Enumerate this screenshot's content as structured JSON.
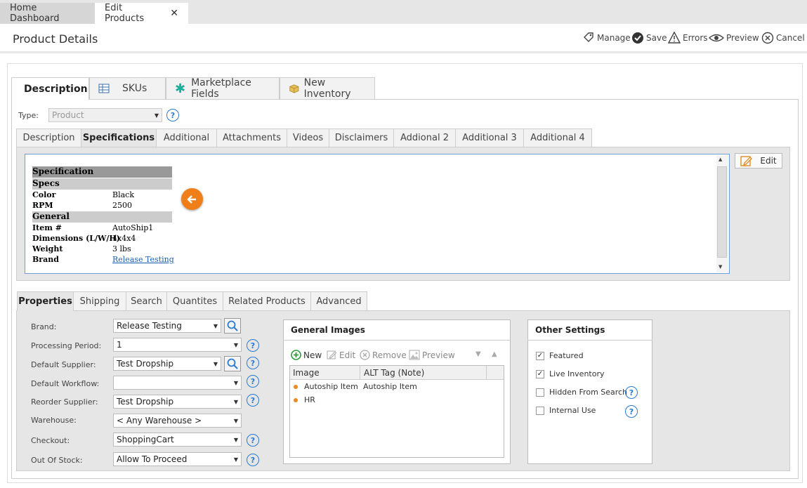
{
  "tabs": {
    "home": "Home Dashboard",
    "edit": "Edit Products"
  },
  "header": {
    "title": "Product Details",
    "manage": "Manage",
    "save": "Save",
    "errors": "Errors",
    "preview": "Preview",
    "cancel": "Cancel"
  },
  "main_tabs": [
    "Description",
    "SKUs",
    "Marketplace Fields",
    "New Inventory"
  ],
  "type": {
    "label": "Type:",
    "value": "Product"
  },
  "sub_tabs": [
    "Description",
    "Specifications",
    "Additional",
    "Attachments",
    "Videos",
    "Disclaimers",
    "Addional 2",
    "Additional 3",
    "Additional 4"
  ],
  "spec": {
    "heading": "Specification",
    "specs_title": "Specs",
    "specs": [
      {
        "k": "Color",
        "v": "Black"
      },
      {
        "k": "RPM",
        "v": "2500"
      }
    ],
    "general_title": "General",
    "general": [
      {
        "k": "Item #",
        "v": "AutoShip1"
      },
      {
        "k": "Dimensions (L/W/H)",
        "v": "4x4x4"
      },
      {
        "k": "Weight",
        "v": "3 lbs"
      }
    ],
    "brand_key": "Brand",
    "brand_link": "Release Testing"
  },
  "edit_label": "Edit",
  "prop_tabs": [
    "Properties",
    "Shipping",
    "Search",
    "Quantites",
    "Related Products",
    "Advanced"
  ],
  "form": {
    "brand": {
      "label": "Brand:",
      "value": "Release Testing"
    },
    "processing": {
      "label": "Processing Period:",
      "value": "1"
    },
    "supplier": {
      "label": "Default Supplier:",
      "value": "Test Dropship"
    },
    "workflow": {
      "label": "Default Workflow:",
      "value": ""
    },
    "reorder": {
      "label": "Reorder Supplier:",
      "value": "Test Dropship"
    },
    "warehouse": {
      "label": "Warehouse:",
      "value": "< Any Warehouse >"
    },
    "checkout": {
      "label": "Checkout:",
      "value": "ShoppingCart"
    },
    "outofstock": {
      "label": "Out Of Stock:",
      "value": "Allow To Proceed"
    }
  },
  "images": {
    "title": "General Images",
    "new": "New",
    "edit": "Edit",
    "remove": "Remove",
    "preview": "Preview",
    "col_image": "Image",
    "col_alt": "ALT Tag (Note)",
    "rows": [
      {
        "image": "Autoship Item",
        "alt": "Autoship Item"
      },
      {
        "image": "HR",
        "alt": ""
      }
    ]
  },
  "other": {
    "title": "Other Settings",
    "featured": "Featured",
    "live": "Live Inventory",
    "hidden": "Hidden From Search",
    "internal": "Internal Use"
  }
}
